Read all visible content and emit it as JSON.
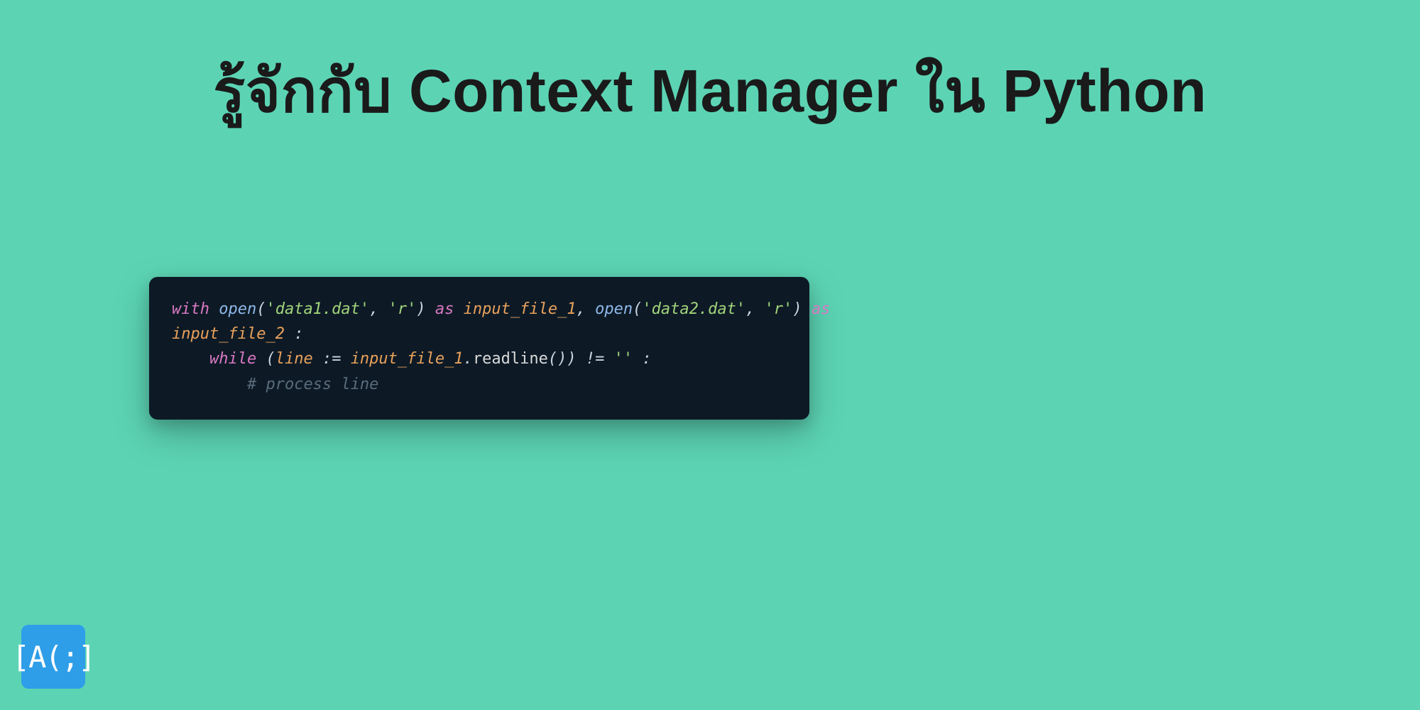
{
  "title": "รู้จักกับ Context Manager ใน Python",
  "logo": "[A(;]",
  "code": {
    "l1_kw1": "with",
    "l1_fn1": "open",
    "l1_p1": "(",
    "l1_s1": "'data1.dat'",
    "l1_c1": ", ",
    "l1_s2": "'r'",
    "l1_p2": ") ",
    "l1_kw2": "as",
    "l1_sp1": " ",
    "l1_v1": "input_file_1",
    "l1_c2": ", ",
    "l1_fn2": "open",
    "l1_p3": "(",
    "l1_s3": "'data2.dat'",
    "l1_c3": ", ",
    "l1_s4": "'r'",
    "l1_p4": ") ",
    "l1_kw3": "as",
    "l2_v1": "input_file_2",
    "l2_p1": " :",
    "l3_indent": "    ",
    "l3_kw1": "while",
    "l3_sp1": " (",
    "l3_var1": "line",
    "l3_op1": " := ",
    "l3_var2": "input_file_1",
    "l3_dot": ".",
    "l3_meth": "readline",
    "l3_p1": "()) != ",
    "l3_s1": "''",
    "l3_p2": " :",
    "l4_indent": "        ",
    "l4_comment": "# process line"
  }
}
